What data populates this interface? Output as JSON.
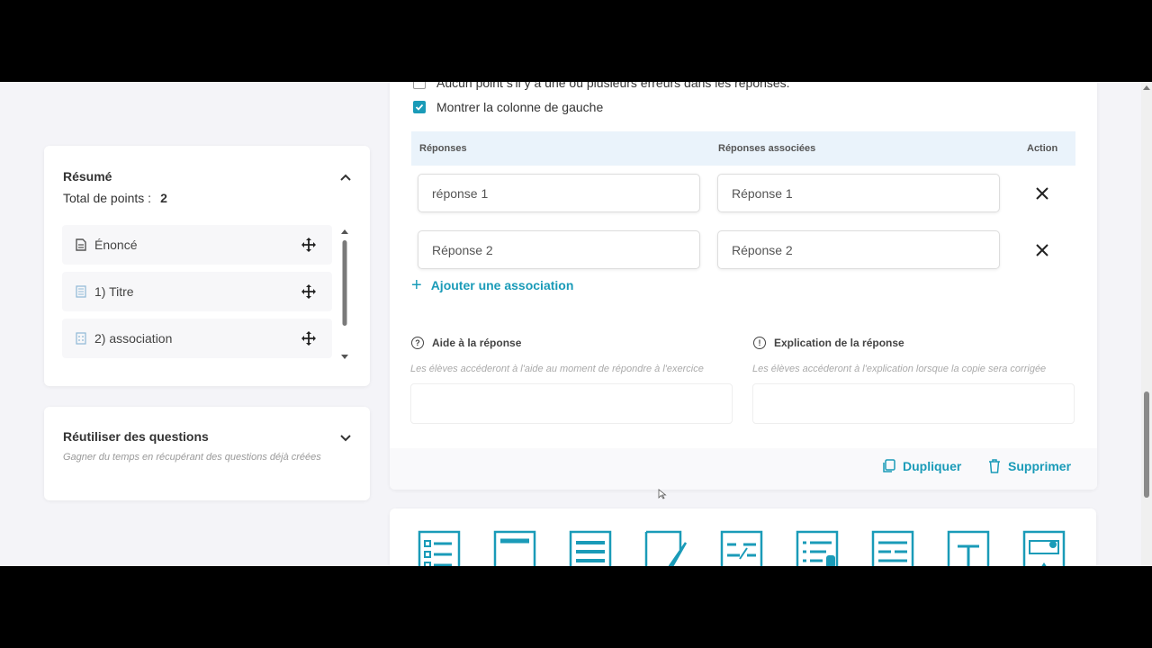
{
  "summary": {
    "title": "Résumé",
    "total_label": "Total de points :",
    "total_value": "2",
    "items": [
      {
        "label": "Énoncé",
        "icon": "document-icon"
      },
      {
        "label": "1) Titre",
        "icon": "title-block-icon"
      },
      {
        "label": "2) association",
        "icon": "association-icon"
      }
    ]
  },
  "reuse": {
    "title": "Réutiliser des questions",
    "description": "Gagner du temps en récupérant des questions déjà créées"
  },
  "options": {
    "no_points_label": "Aucun point s'il y a une ou plusieurs erreurs dans les réponses.",
    "show_left_column_label": "Montrer la colonne de gauche",
    "show_left_column_checked": true
  },
  "table": {
    "col_answers": "Réponses",
    "col_associated": "Réponses associées",
    "col_action": "Action",
    "rows": [
      {
        "answer": "réponse 1",
        "associated": "Réponse 1"
      },
      {
        "answer": "Réponse 2",
        "associated": "Réponse 2"
      }
    ],
    "add_label": "Ajouter une association"
  },
  "help": {
    "title": "Aide à la réponse",
    "description": "Les élèves accéderont à l'aide au moment de répondre à l'exercice"
  },
  "explanation": {
    "title": "Explication de la réponse",
    "description": "Les élèves accéderont à l'explication lorsque la copie sera corrigée"
  },
  "footer": {
    "duplicate_label": "Dupliquer",
    "delete_label": "Supprimer"
  },
  "question_types": [
    "multiple-choice-icon",
    "title-block-icon",
    "text-block-icon",
    "free-writing-icon",
    "fill-blanks-icon",
    "list-media-icon",
    "text-lines-icon",
    "text-tool-icon",
    "image-icon"
  ],
  "colors": {
    "accent": "#1a9bb8",
    "table_header_bg": "#eaf3fb"
  }
}
